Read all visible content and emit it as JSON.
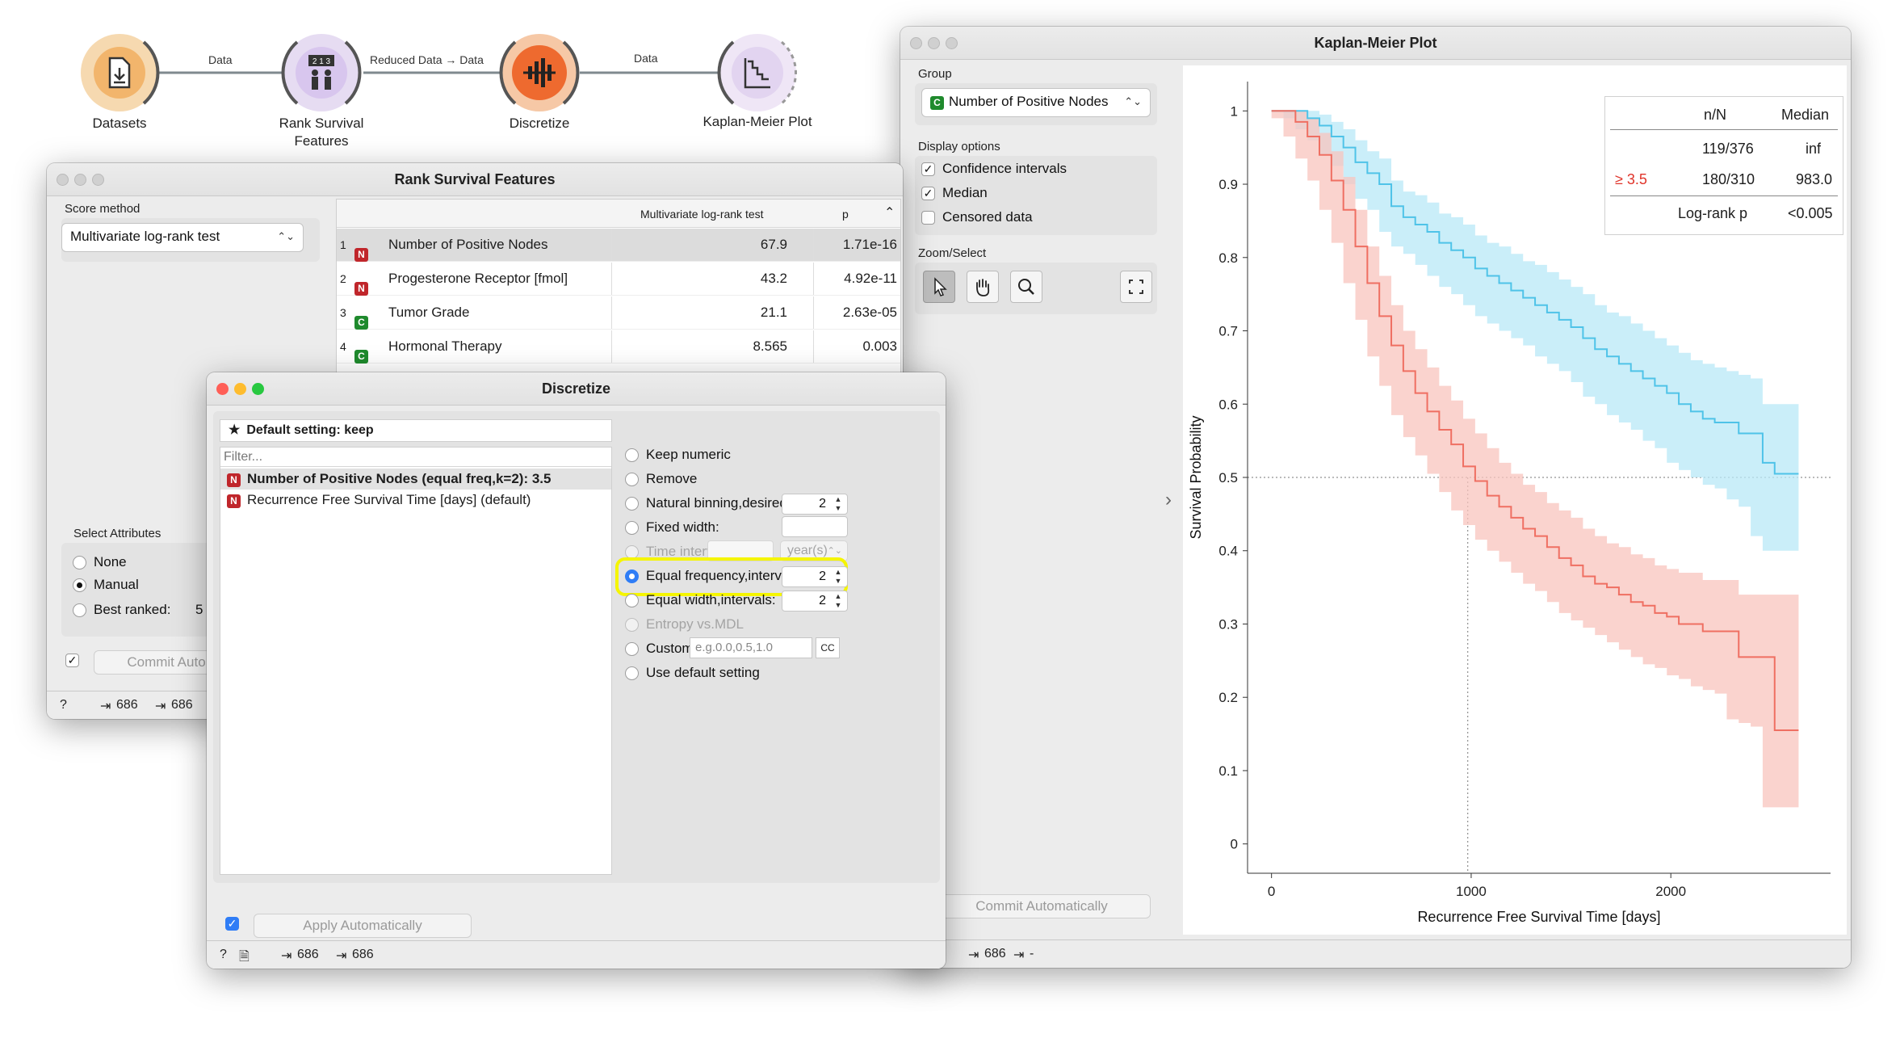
{
  "workflow": {
    "nodes": [
      {
        "label": "Datasets",
        "icon": "datasets-icon"
      },
      {
        "label": "Rank Survival\nFeatures",
        "icon": "rank-icon"
      },
      {
        "label": "Discretize",
        "icon": "discretize-icon"
      },
      {
        "label": "Kaplan-Meier Plot",
        "icon": "kaplan-meier-icon"
      }
    ],
    "links": [
      "Data",
      "Reduced Data → Data",
      "Data"
    ]
  },
  "rank": {
    "title": "Rank Survival Features",
    "score_method_label": "Score method",
    "score_method_value": "Multivariate log-rank test",
    "table_headers": [
      "Multivariate log-rank test",
      "p"
    ],
    "rows": [
      {
        "idx": "1",
        "type": "N",
        "name": "Number of Positive Nodes",
        "score": "67.9",
        "p": "1.71e-16"
      },
      {
        "idx": "2",
        "type": "N",
        "name": "Progesterone Receptor [fmol]",
        "score": "43.2",
        "p": "4.92e-11"
      },
      {
        "idx": "3",
        "type": "C",
        "name": "Tumor Grade",
        "score": "21.1",
        "p": "2.63e-05"
      },
      {
        "idx": "4",
        "type": "C",
        "name": "Hormonal Therapy",
        "score": "8.565",
        "p": "0.003"
      }
    ],
    "select_attributes_label": "Select Attributes",
    "select_options": [
      "None",
      "Manual",
      "Best ranked:"
    ],
    "best_ranked_value": "5",
    "commit_label": "Commit Auto",
    "status_in": "686",
    "status_out": "686"
  },
  "discretize": {
    "title": "Discretize",
    "default_setting": "Default setting: keep",
    "filter_placeholder": "Filter...",
    "variables": [
      {
        "type": "N",
        "text": "Number of Positive Nodes (equal freq,k=2): 3.5",
        "bold": true
      },
      {
        "type": "N",
        "text": "Recurrence Free Survival Time [days] (default)",
        "bold": false
      }
    ],
    "options": {
      "keep_numeric": "Keep numeric",
      "remove": "Remove",
      "natural_binning": "Natural binning,desired bins:",
      "natural_binning_value": "2",
      "fixed_width": "Fixed width:",
      "time_interval": "Time interval:",
      "time_unit": "year(s)",
      "equal_frequency": "Equal frequency,intervals:",
      "equal_frequency_value": "2",
      "equal_width": "Equal width,intervals:",
      "equal_width_value": "2",
      "entropy_mdl": "Entropy vs.MDL",
      "custom": "Custom:",
      "custom_placeholder": "e.g.0.0,0.5,1.0",
      "custom_button": "CC",
      "use_default": "Use default setting"
    },
    "highlight_color": "#f5f500",
    "apply_label": "Apply Automatically",
    "status_in": "686",
    "status_out": "686"
  },
  "km": {
    "title": "Kaplan-Meier Plot",
    "group_label": "Group",
    "group_value": "Number of Positive Nodes",
    "display_options_label": "Display options",
    "display_options": [
      {
        "label": "Confidence intervals",
        "checked": true
      },
      {
        "label": "Median",
        "checked": true
      },
      {
        "label": "Censored data",
        "checked": false
      }
    ],
    "zoom_select_label": "Zoom/Select",
    "commit_label": "Commit Automatically",
    "status_in": "686",
    "status_out": "-",
    "legend": {
      "headers": [
        "n/N",
        "Median"
      ],
      "rows": [
        {
          "group": "",
          "nN": "119/376",
          "median": "inf"
        },
        {
          "group": "≥ 3.5",
          "nN": "180/310",
          "median": "983.0"
        }
      ],
      "logrank_label": "Log-rank p",
      "logrank_value": "<0.005"
    }
  },
  "chart_data": {
    "type": "line",
    "xlabel": "Recurrence Free Survival Time [days]",
    "ylabel": "Survival Probability",
    "xlim": [
      -120,
      2800
    ],
    "ylim": [
      -0.04,
      1.04
    ],
    "x_ticks": [
      0,
      1000,
      2000
    ],
    "y_ticks": [
      0,
      0.1,
      0.2,
      0.3,
      0.4,
      0.5,
      0.6,
      0.7,
      0.8,
      0.9,
      1
    ],
    "y_tick_labels": [
      "0",
      "0.1",
      "0.2",
      "0.3",
      "0.4",
      "0.5",
      "0.6",
      "0.7",
      "0.8",
      "0.9",
      "1"
    ],
    "x_tick_labels": [
      "0",
      "1000",
      "2000"
    ],
    "median_line": {
      "y": 0.5,
      "x": 983
    },
    "colors": {
      "low": "#4fc3e8",
      "high": "#ef6f62",
      "low_band": "#b8e8f7",
      "high_band": "#f8c4bd"
    },
    "series": [
      {
        "x": [
          0,
          60,
          120,
          180,
          240,
          300,
          360,
          420,
          480,
          540,
          600,
          660,
          720,
          780,
          840,
          900,
          960,
          1020,
          1080,
          1140,
          1200,
          1260,
          1320,
          1380,
          1440,
          1500,
          1560,
          1620,
          1680,
          1740,
          1800,
          1860,
          1920,
          1980,
          2040,
          2100,
          2160,
          2220,
          2280,
          2340,
          2400,
          2460,
          2520,
          2580,
          2640
        ],
        "values": [
          1.0,
          1.0,
          1.0,
          0.99,
          0.98,
          0.965,
          0.95,
          0.93,
          0.915,
          0.9,
          0.87,
          0.855,
          0.845,
          0.835,
          0.82,
          0.81,
          0.8,
          0.785,
          0.775,
          0.765,
          0.755,
          0.745,
          0.735,
          0.725,
          0.715,
          0.705,
          0.69,
          0.675,
          0.665,
          0.655,
          0.645,
          0.635,
          0.625,
          0.615,
          0.6,
          0.59,
          0.58,
          0.575,
          0.575,
          0.56,
          0.56,
          0.52,
          0.505,
          0.505,
          0.505
        ],
        "lower": [
          1.0,
          1.0,
          0.99,
          0.975,
          0.96,
          0.94,
          0.925,
          0.9,
          0.88,
          0.865,
          0.835,
          0.815,
          0.805,
          0.79,
          0.775,
          0.76,
          0.75,
          0.735,
          0.72,
          0.71,
          0.7,
          0.69,
          0.68,
          0.665,
          0.655,
          0.645,
          0.63,
          0.61,
          0.6,
          0.585,
          0.575,
          0.565,
          0.55,
          0.54,
          0.52,
          0.51,
          0.5,
          0.49,
          0.485,
          0.47,
          0.46,
          0.42,
          0.4,
          0.4,
          0.4
        ],
        "upper": [
          1.0,
          1.0,
          1.0,
          1.0,
          0.995,
          0.985,
          0.975,
          0.96,
          0.945,
          0.935,
          0.905,
          0.89,
          0.885,
          0.875,
          0.86,
          0.855,
          0.845,
          0.83,
          0.82,
          0.815,
          0.805,
          0.795,
          0.79,
          0.78,
          0.77,
          0.76,
          0.75,
          0.735,
          0.725,
          0.72,
          0.71,
          0.7,
          0.69,
          0.68,
          0.67,
          0.66,
          0.655,
          0.65,
          0.645,
          0.64,
          0.635,
          0.6,
          0.6,
          0.6,
          0.6
        ]
      },
      {
        "name": "≥ 3.5",
        "x": [
          0,
          60,
          120,
          180,
          240,
          300,
          360,
          420,
          480,
          540,
          600,
          660,
          720,
          780,
          840,
          900,
          960,
          1020,
          1080,
          1140,
          1200,
          1260,
          1320,
          1380,
          1440,
          1500,
          1560,
          1620,
          1680,
          1740,
          1800,
          1860,
          1920,
          1980,
          2040,
          2100,
          2160,
          2220,
          2280,
          2340,
          2400,
          2460,
          2520,
          2580,
          2640
        ],
        "values": [
          1.0,
          1.0,
          0.985,
          0.965,
          0.94,
          0.905,
          0.865,
          0.815,
          0.765,
          0.72,
          0.68,
          0.645,
          0.615,
          0.59,
          0.565,
          0.545,
          0.515,
          0.495,
          0.475,
          0.46,
          0.445,
          0.43,
          0.42,
          0.405,
          0.39,
          0.38,
          0.365,
          0.355,
          0.35,
          0.34,
          0.33,
          0.325,
          0.315,
          0.31,
          0.3,
          0.3,
          0.29,
          0.29,
          0.29,
          0.255,
          0.255,
          0.255,
          0.155,
          0.155,
          0.155
        ],
        "lower": [
          1.0,
          0.99,
          0.965,
          0.935,
          0.905,
          0.865,
          0.82,
          0.765,
          0.715,
          0.665,
          0.625,
          0.585,
          0.555,
          0.53,
          0.505,
          0.48,
          0.455,
          0.435,
          0.415,
          0.4,
          0.385,
          0.37,
          0.355,
          0.345,
          0.33,
          0.315,
          0.305,
          0.295,
          0.285,
          0.275,
          0.265,
          0.255,
          0.245,
          0.24,
          0.23,
          0.225,
          0.215,
          0.21,
          0.205,
          0.17,
          0.165,
          0.16,
          0.05,
          0.05,
          0.05
        ],
        "upper": [
          1.0,
          1.0,
          1.0,
          0.99,
          0.97,
          0.945,
          0.91,
          0.865,
          0.815,
          0.775,
          0.735,
          0.7,
          0.675,
          0.65,
          0.625,
          0.605,
          0.58,
          0.56,
          0.54,
          0.52,
          0.505,
          0.49,
          0.48,
          0.465,
          0.455,
          0.445,
          0.43,
          0.42,
          0.41,
          0.405,
          0.395,
          0.39,
          0.38,
          0.375,
          0.37,
          0.37,
          0.36,
          0.36,
          0.36,
          0.34,
          0.34,
          0.34,
          0.34,
          0.34,
          0.34
        ]
      }
    ]
  }
}
